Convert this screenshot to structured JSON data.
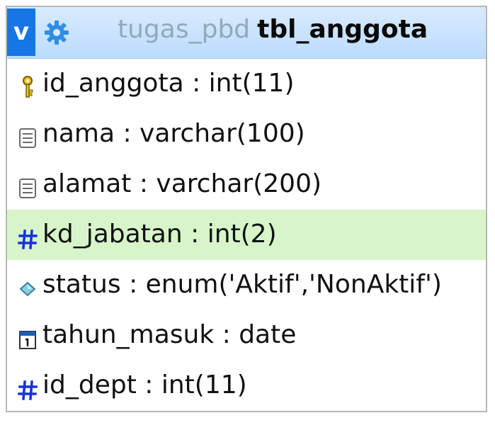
{
  "header": {
    "toggle_label": "v",
    "database": "tugas_pbd",
    "table": "tbl_anggota"
  },
  "fields": [
    {
      "name": "id_anggota",
      "sep": " : ",
      "type": "int(11)",
      "icon": "primary-key-icon",
      "highlight": false
    },
    {
      "name": "nama",
      "sep": " : ",
      "type": "varchar(100)",
      "icon": "text-field-icon",
      "highlight": false
    },
    {
      "name": "alamat",
      "sep": " : ",
      "type": "varchar(200)",
      "icon": "text-field-icon",
      "highlight": false
    },
    {
      "name": "kd_jabatan",
      "sep": " : ",
      "type": "int(2)",
      "icon": "numeric-field-icon",
      "highlight": true
    },
    {
      "name": "status",
      "sep": " : ",
      "type": "enum('Aktif','NonAktif')",
      "icon": "enum-field-icon",
      "highlight": false
    },
    {
      "name": "tahun_masuk",
      "sep": " : ",
      "type": "date",
      "icon": "date-field-icon",
      "highlight": false
    },
    {
      "name": "id_dept",
      "sep": " : ",
      "type": "int(11)",
      "icon": "numeric-field-icon",
      "highlight": false
    }
  ],
  "colors": {
    "header_bg": "#bcdcff",
    "toggle_bg": "#1676e6",
    "gear": "#2e8ee8",
    "highlight_row": "#d7f5c9",
    "hash_icon": "#1530e0",
    "db_name_text": "#93a9bb"
  }
}
